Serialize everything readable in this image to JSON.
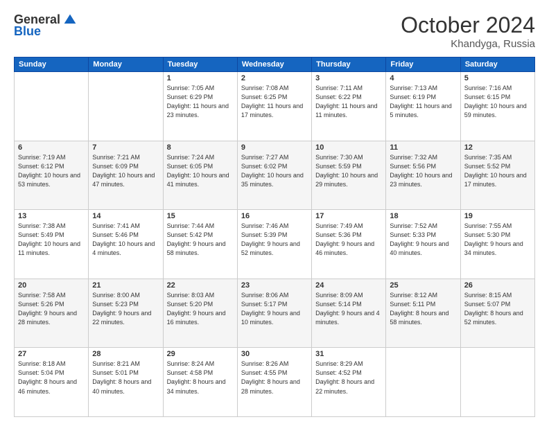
{
  "header": {
    "logo_general": "General",
    "logo_blue": "Blue",
    "month": "October 2024",
    "location": "Khandyga, Russia"
  },
  "days_of_week": [
    "Sunday",
    "Monday",
    "Tuesday",
    "Wednesday",
    "Thursday",
    "Friday",
    "Saturday"
  ],
  "weeks": [
    [
      {
        "day": "",
        "sunrise": "",
        "sunset": "",
        "daylight": ""
      },
      {
        "day": "",
        "sunrise": "",
        "sunset": "",
        "daylight": ""
      },
      {
        "day": "1",
        "sunrise": "Sunrise: 7:05 AM",
        "sunset": "Sunset: 6:29 PM",
        "daylight": "Daylight: 11 hours and 23 minutes."
      },
      {
        "day": "2",
        "sunrise": "Sunrise: 7:08 AM",
        "sunset": "Sunset: 6:25 PM",
        "daylight": "Daylight: 11 hours and 17 minutes."
      },
      {
        "day": "3",
        "sunrise": "Sunrise: 7:11 AM",
        "sunset": "Sunset: 6:22 PM",
        "daylight": "Daylight: 11 hours and 11 minutes."
      },
      {
        "day": "4",
        "sunrise": "Sunrise: 7:13 AM",
        "sunset": "Sunset: 6:19 PM",
        "daylight": "Daylight: 11 hours and 5 minutes."
      },
      {
        "day": "5",
        "sunrise": "Sunrise: 7:16 AM",
        "sunset": "Sunset: 6:15 PM",
        "daylight": "Daylight: 10 hours and 59 minutes."
      }
    ],
    [
      {
        "day": "6",
        "sunrise": "Sunrise: 7:19 AM",
        "sunset": "Sunset: 6:12 PM",
        "daylight": "Daylight: 10 hours and 53 minutes."
      },
      {
        "day": "7",
        "sunrise": "Sunrise: 7:21 AM",
        "sunset": "Sunset: 6:09 PM",
        "daylight": "Daylight: 10 hours and 47 minutes."
      },
      {
        "day": "8",
        "sunrise": "Sunrise: 7:24 AM",
        "sunset": "Sunset: 6:05 PM",
        "daylight": "Daylight: 10 hours and 41 minutes."
      },
      {
        "day": "9",
        "sunrise": "Sunrise: 7:27 AM",
        "sunset": "Sunset: 6:02 PM",
        "daylight": "Daylight: 10 hours and 35 minutes."
      },
      {
        "day": "10",
        "sunrise": "Sunrise: 7:30 AM",
        "sunset": "Sunset: 5:59 PM",
        "daylight": "Daylight: 10 hours and 29 minutes."
      },
      {
        "day": "11",
        "sunrise": "Sunrise: 7:32 AM",
        "sunset": "Sunset: 5:56 PM",
        "daylight": "Daylight: 10 hours and 23 minutes."
      },
      {
        "day": "12",
        "sunrise": "Sunrise: 7:35 AM",
        "sunset": "Sunset: 5:52 PM",
        "daylight": "Daylight: 10 hours and 17 minutes."
      }
    ],
    [
      {
        "day": "13",
        "sunrise": "Sunrise: 7:38 AM",
        "sunset": "Sunset: 5:49 PM",
        "daylight": "Daylight: 10 hours and 11 minutes."
      },
      {
        "day": "14",
        "sunrise": "Sunrise: 7:41 AM",
        "sunset": "Sunset: 5:46 PM",
        "daylight": "Daylight: 10 hours and 4 minutes."
      },
      {
        "day": "15",
        "sunrise": "Sunrise: 7:44 AM",
        "sunset": "Sunset: 5:42 PM",
        "daylight": "Daylight: 9 hours and 58 minutes."
      },
      {
        "day": "16",
        "sunrise": "Sunrise: 7:46 AM",
        "sunset": "Sunset: 5:39 PM",
        "daylight": "Daylight: 9 hours and 52 minutes."
      },
      {
        "day": "17",
        "sunrise": "Sunrise: 7:49 AM",
        "sunset": "Sunset: 5:36 PM",
        "daylight": "Daylight: 9 hours and 46 minutes."
      },
      {
        "day": "18",
        "sunrise": "Sunrise: 7:52 AM",
        "sunset": "Sunset: 5:33 PM",
        "daylight": "Daylight: 9 hours and 40 minutes."
      },
      {
        "day": "19",
        "sunrise": "Sunrise: 7:55 AM",
        "sunset": "Sunset: 5:30 PM",
        "daylight": "Daylight: 9 hours and 34 minutes."
      }
    ],
    [
      {
        "day": "20",
        "sunrise": "Sunrise: 7:58 AM",
        "sunset": "Sunset: 5:26 PM",
        "daylight": "Daylight: 9 hours and 28 minutes."
      },
      {
        "day": "21",
        "sunrise": "Sunrise: 8:00 AM",
        "sunset": "Sunset: 5:23 PM",
        "daylight": "Daylight: 9 hours and 22 minutes."
      },
      {
        "day": "22",
        "sunrise": "Sunrise: 8:03 AM",
        "sunset": "Sunset: 5:20 PM",
        "daylight": "Daylight: 9 hours and 16 minutes."
      },
      {
        "day": "23",
        "sunrise": "Sunrise: 8:06 AM",
        "sunset": "Sunset: 5:17 PM",
        "daylight": "Daylight: 9 hours and 10 minutes."
      },
      {
        "day": "24",
        "sunrise": "Sunrise: 8:09 AM",
        "sunset": "Sunset: 5:14 PM",
        "daylight": "Daylight: 9 hours and 4 minutes."
      },
      {
        "day": "25",
        "sunrise": "Sunrise: 8:12 AM",
        "sunset": "Sunset: 5:11 PM",
        "daylight": "Daylight: 8 hours and 58 minutes."
      },
      {
        "day": "26",
        "sunrise": "Sunrise: 8:15 AM",
        "sunset": "Sunset: 5:07 PM",
        "daylight": "Daylight: 8 hours and 52 minutes."
      }
    ],
    [
      {
        "day": "27",
        "sunrise": "Sunrise: 8:18 AM",
        "sunset": "Sunset: 5:04 PM",
        "daylight": "Daylight: 8 hours and 46 minutes."
      },
      {
        "day": "28",
        "sunrise": "Sunrise: 8:21 AM",
        "sunset": "Sunset: 5:01 PM",
        "daylight": "Daylight: 8 hours and 40 minutes."
      },
      {
        "day": "29",
        "sunrise": "Sunrise: 8:24 AM",
        "sunset": "Sunset: 4:58 PM",
        "daylight": "Daylight: 8 hours and 34 minutes."
      },
      {
        "day": "30",
        "sunrise": "Sunrise: 8:26 AM",
        "sunset": "Sunset: 4:55 PM",
        "daylight": "Daylight: 8 hours and 28 minutes."
      },
      {
        "day": "31",
        "sunrise": "Sunrise: 8:29 AM",
        "sunset": "Sunset: 4:52 PM",
        "daylight": "Daylight: 8 hours and 22 minutes."
      },
      {
        "day": "",
        "sunrise": "",
        "sunset": "",
        "daylight": ""
      },
      {
        "day": "",
        "sunrise": "",
        "sunset": "",
        "daylight": ""
      }
    ]
  ]
}
